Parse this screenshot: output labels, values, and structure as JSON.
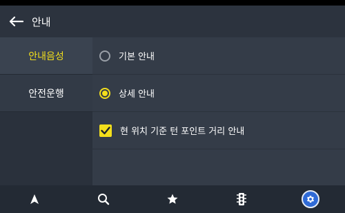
{
  "header": {
    "title": "안내"
  },
  "sidebar": {
    "items": [
      {
        "label": "안내음성",
        "active": true
      },
      {
        "label": "안전운행",
        "active": false
      }
    ]
  },
  "content": {
    "options": [
      {
        "type": "radio",
        "label": "기본 안내",
        "selected": false
      },
      {
        "type": "radio",
        "label": "상세 안내",
        "selected": true
      },
      {
        "type": "checkbox",
        "label": "현 위치 기준 턴 포인트 거리 안내",
        "checked": true
      }
    ]
  },
  "bottom_nav": {
    "items": [
      {
        "icon": "navigation-arrow-icon"
      },
      {
        "icon": "search-icon"
      },
      {
        "icon": "star-icon"
      },
      {
        "icon": "traffic-light-icon"
      },
      {
        "icon": "gear-icon",
        "active": true
      }
    ]
  },
  "colors": {
    "accent": "#f3df1c",
    "header_bg": "#2c333e",
    "content_bg": "#343c48",
    "active_button": "#2f6ad6"
  }
}
